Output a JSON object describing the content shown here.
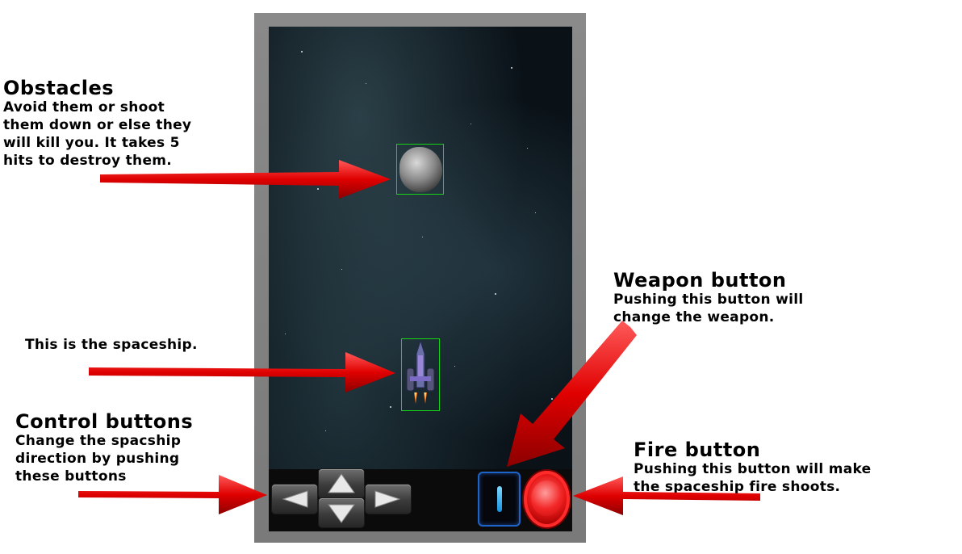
{
  "callouts": {
    "obstacles": {
      "title": "Obstacles",
      "description": "Avoid them or shoot\nthem down or else they\nwill kill you. It takes 5\nhits to destroy them."
    },
    "spaceship": {
      "description": "This is the spaceship."
    },
    "control": {
      "title": "Control buttons",
      "description": "Change the spacship\ndirection by pushing\nthese buttons"
    },
    "weapon": {
      "title": "Weapon button",
      "description": "Pushing this button will\nchange the weapon."
    },
    "fire": {
      "title": "Fire button",
      "description": "Pushing this button will make\nthe spaceship fire shoots."
    }
  },
  "icons": {
    "arrow": "red-arrow-icon",
    "asteroid": "asteroid-icon",
    "spaceship": "spaceship-icon",
    "left": "arrow-left-icon",
    "up": "arrow-up-icon",
    "down": "arrow-down-icon",
    "right": "arrow-right-icon",
    "weapon": "weapon-icon",
    "fire": "fire-icon"
  },
  "colors": {
    "arrow_red": "#e00000",
    "hitbox_green": "#14d414",
    "fire_red": "#e61818",
    "weapon_blue": "#1d64c8",
    "frame_gray": "#808080"
  }
}
